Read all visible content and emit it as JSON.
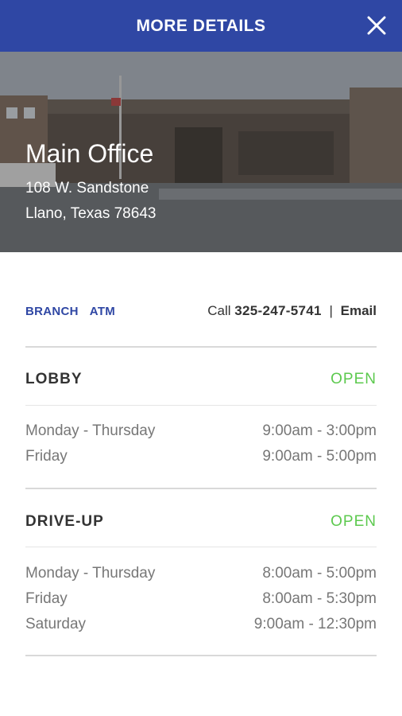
{
  "header": {
    "title": "MORE DETAILS",
    "close_icon": "close-icon"
  },
  "location": {
    "name": "Main Office",
    "address_line1": "108 W. Sandstone",
    "address_line2": "Llano, Texas 78643"
  },
  "tags": [
    "BRANCH",
    "ATM"
  ],
  "contact": {
    "call_label": "Call",
    "phone": "325-247-5741",
    "separator": "|",
    "email_label": "Email"
  },
  "sections": [
    {
      "title": "LOBBY",
      "status": "OPEN",
      "hours": [
        {
          "days": "Monday - Thursday",
          "time": "9:00am - 3:00pm"
        },
        {
          "days": "Friday",
          "time": "9:00am - 5:00pm"
        }
      ]
    },
    {
      "title": "DRIVE-UP",
      "status": "OPEN",
      "hours": [
        {
          "days": "Monday - Thursday",
          "time": "8:00am - 5:00pm"
        },
        {
          "days": "Friday",
          "time": "8:00am - 5:30pm"
        },
        {
          "days": "Saturday",
          "time": "9:00am - 12:30pm"
        }
      ]
    }
  ],
  "colors": {
    "header_bg": "#2f47a4",
    "tag": "#2f47a4",
    "open_status": "#5cc94e"
  }
}
